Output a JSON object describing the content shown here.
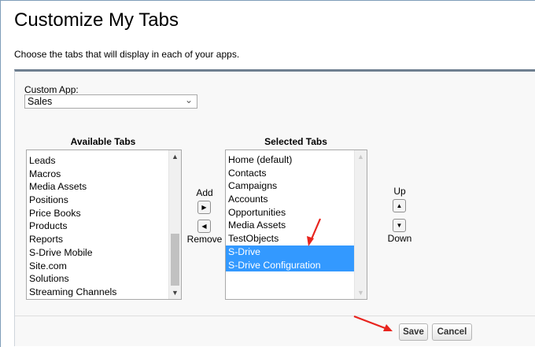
{
  "page": {
    "title": "Customize My Tabs",
    "description": "Choose the tabs that will display in each of your apps."
  },
  "custom_app": {
    "label": "Custom App:",
    "selected": "Sales"
  },
  "available_tabs": {
    "header": "Available Tabs",
    "items": [
      "Leads",
      "Macros",
      "Media Assets",
      "Positions",
      "Price Books",
      "Products",
      "Reports",
      "S-Drive Mobile",
      "Site.com",
      "Solutions",
      "Streaming Channels"
    ]
  },
  "selected_tabs": {
    "header": "Selected Tabs",
    "items": [
      "Home (default)",
      "Contacts",
      "Campaigns",
      "Accounts",
      "Opportunities",
      "Media Assets",
      "TestObjects",
      "S-Drive",
      "S-Drive Configuration"
    ],
    "highlighted": [
      "S-Drive",
      "S-Drive Configuration"
    ]
  },
  "controls": {
    "add_label": "Add",
    "remove_label": "Remove",
    "up_label": "Up",
    "down_label": "Down",
    "add_icon": "right-triangle-icon",
    "remove_icon": "left-triangle-icon",
    "up_icon": "up-triangle-icon",
    "down_icon": "down-triangle-icon"
  },
  "buttons": {
    "save": "Save",
    "cancel": "Cancel"
  },
  "colors": {
    "selection": "#3399ff",
    "annotation_arrow": "#e8241e",
    "panel_border": "#6e7f90"
  }
}
